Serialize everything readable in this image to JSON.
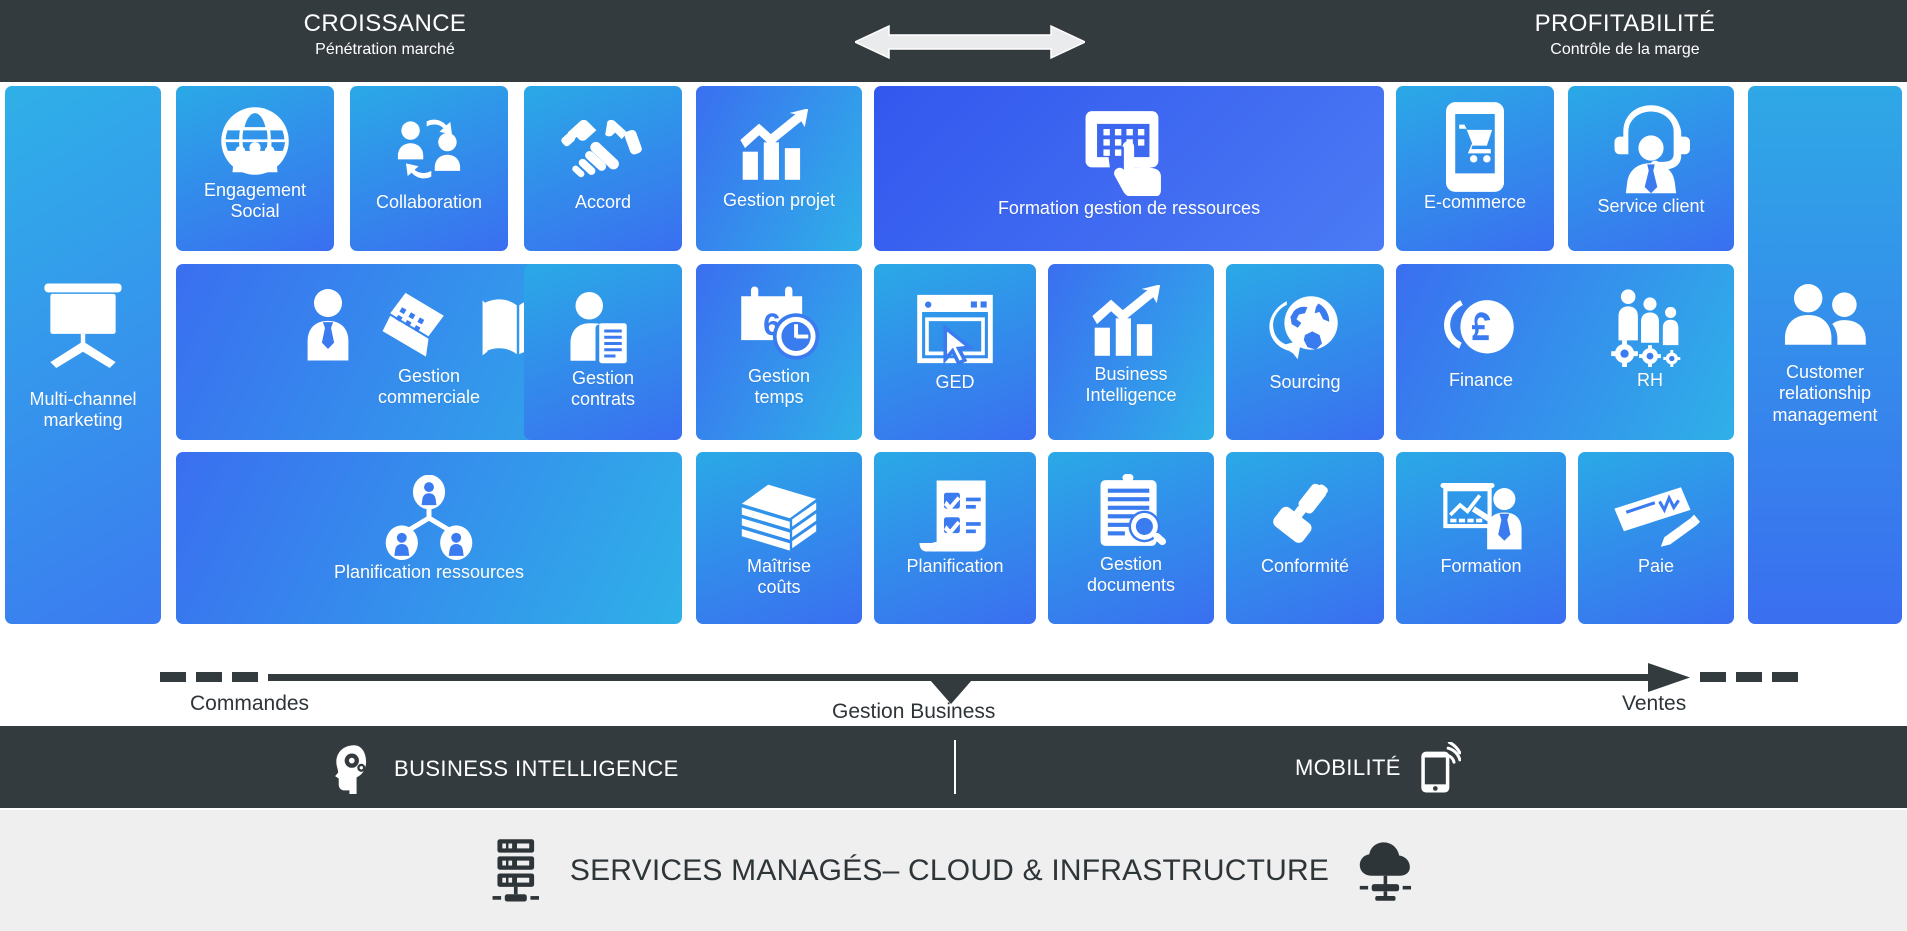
{
  "header": {
    "left": {
      "title": "CROISSANCE",
      "subtitle": "Pénétration marché"
    },
    "right": {
      "title": "PROFITABILITÉ",
      "subtitle": "Contrôle de la marge"
    },
    "arrow_icon": "double-headed-horizontal-arrow-icon",
    "background_color": "#343b3f",
    "text_color": "#ffffff"
  },
  "grid": {
    "left_column": {
      "label": "Multi-channel\nmarketing",
      "label_line1": "Multi-channel",
      "label_line2": "marketing",
      "icon": "projector-screen-icon"
    },
    "right_column": {
      "label_line1": "Customer",
      "label_line2": "relationship",
      "label_line3": "management",
      "icon": "two-people-icon"
    },
    "tiles": [
      {
        "label": "Engagement\nSocial",
        "line1": "Engagement",
        "line2": "Social",
        "icon": "globe-people-icon"
      },
      {
        "label": "Collaboration",
        "line1": "Collaboration",
        "line2": "",
        "icon": "collaboration-cycle-icon"
      },
      {
        "label": "Accord",
        "line1": "Accord",
        "line2": "",
        "icon": "handshake-icon"
      },
      {
        "label": "Gestion projet",
        "line1": "Gestion projet",
        "line2": "",
        "icon": "growth-chart-arrow-icon"
      },
      {
        "label": "Formation gestion de ressources",
        "line1": "Formation gestion de ressources",
        "line2": "",
        "icon": "touch-tablet-icon"
      },
      {
        "label": "E-commerce",
        "line1": "E-commerce",
        "line2": "",
        "icon": "mobile-shopping-cart-icon"
      },
      {
        "label": "Service client",
        "line1": "Service client",
        "line2": "",
        "icon": "headset-agent-icon"
      },
      {
        "label": "Gestion\ncommerciale",
        "line1": "Gestion",
        "line2": "commerciale",
        "icon": "sales-person-laptop-book-icon"
      },
      {
        "label": "Gestion\ncontrats",
        "line1": "Gestion",
        "line2": "contrats",
        "icon": "person-document-icon"
      },
      {
        "label": "Gestion\ntemps",
        "line1": "Gestion",
        "line2": "temps",
        "icon": "calendar-clock-icon"
      },
      {
        "label": "GED",
        "line1": "GED",
        "line2": "",
        "icon": "browser-cursor-icon"
      },
      {
        "label": "Business\nIntelligence",
        "line1": "Business",
        "line2": "Intelligence",
        "icon": "bar-chart-arrow-icon"
      },
      {
        "label": "Sourcing",
        "line1": "Sourcing",
        "line2": "",
        "icon": "globe-arrow-icon"
      },
      {
        "label": "Finance",
        "line1": "Finance",
        "line2": "",
        "icon": "pound-coin-icon"
      },
      {
        "label": "RH",
        "line1": "RH",
        "line2": "",
        "icon": "people-gears-icon"
      },
      {
        "label": "Planification ressources",
        "line1": "Planification ressources",
        "line2": "",
        "icon": "org-chart-people-icon"
      },
      {
        "label": "Maîtrise\ncoûts",
        "line1": "Maîtrise",
        "line2": "coûts",
        "icon": "money-stack-icon"
      },
      {
        "label": "Planification",
        "line1": "Planification",
        "line2": "",
        "icon": "checklist-icon"
      },
      {
        "label": "Gestion\ndocuments",
        "line1": "Gestion",
        "line2": "documents",
        "icon": "clipboard-magnifier-icon"
      },
      {
        "label": "Conformité",
        "line1": "Conformité",
        "line2": "",
        "icon": "gavel-icon"
      },
      {
        "label": "Formation",
        "line1": "Formation",
        "line2": "",
        "icon": "whiteboard-presenter-icon"
      },
      {
        "label": "Paie",
        "line1": "Paie",
        "line2": "",
        "icon": "cheque-pen-icon"
      }
    ]
  },
  "flow": {
    "start_label": "Commandes",
    "middle_label": "Gestion Business",
    "end_label": "Ventes",
    "arrow_icon": "right-arrow-icon",
    "line_color": "#343b3f"
  },
  "services_band": {
    "left": {
      "label": "BUSINESS INTELLIGENCE",
      "icon": "head-gear-icon"
    },
    "right": {
      "label": "MOBILITÉ",
      "icon": "mobile-signal-icon"
    },
    "background_color": "#343b3f"
  },
  "infrastructure_band": {
    "label": "SERVICES MANAGÉS– CLOUD & INFRASTRUCTURE",
    "left_icon": "server-rack-icon",
    "right_icon": "cloud-network-icon",
    "background_color": "#efefef",
    "text_color": "#2e3538"
  }
}
